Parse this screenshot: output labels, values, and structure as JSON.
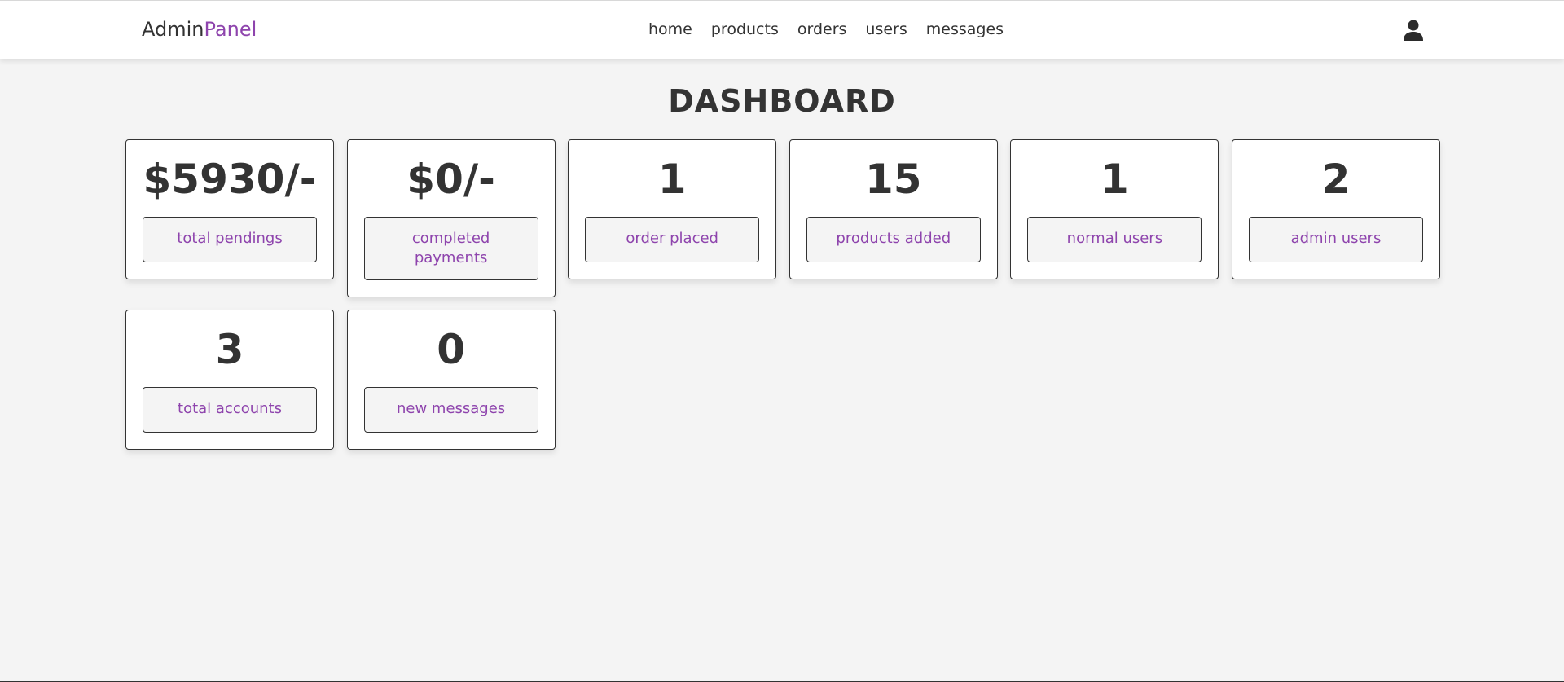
{
  "header": {
    "logo_main": "Admin",
    "logo_accent": "Panel",
    "nav": [
      {
        "label": "home"
      },
      {
        "label": "products"
      },
      {
        "label": "orders"
      },
      {
        "label": "users"
      },
      {
        "label": "messages"
      }
    ],
    "user_icon": "user-icon"
  },
  "page": {
    "title": "DASHBOARD"
  },
  "cards": [
    {
      "value": "$5930/-",
      "label": "total pendings"
    },
    {
      "value": "$0/-",
      "label": "completed payments"
    },
    {
      "value": "1",
      "label": "order placed"
    },
    {
      "value": "15",
      "label": "products added"
    },
    {
      "value": "1",
      "label": "normal users"
    },
    {
      "value": "2",
      "label": "admin users"
    },
    {
      "value": "3",
      "label": "total accounts"
    },
    {
      "value": "0",
      "label": "new messages"
    }
  ],
  "colors": {
    "accent": "#8e44ad",
    "text": "#333333",
    "background": "#f4f4f4",
    "card": "#ffffff"
  }
}
